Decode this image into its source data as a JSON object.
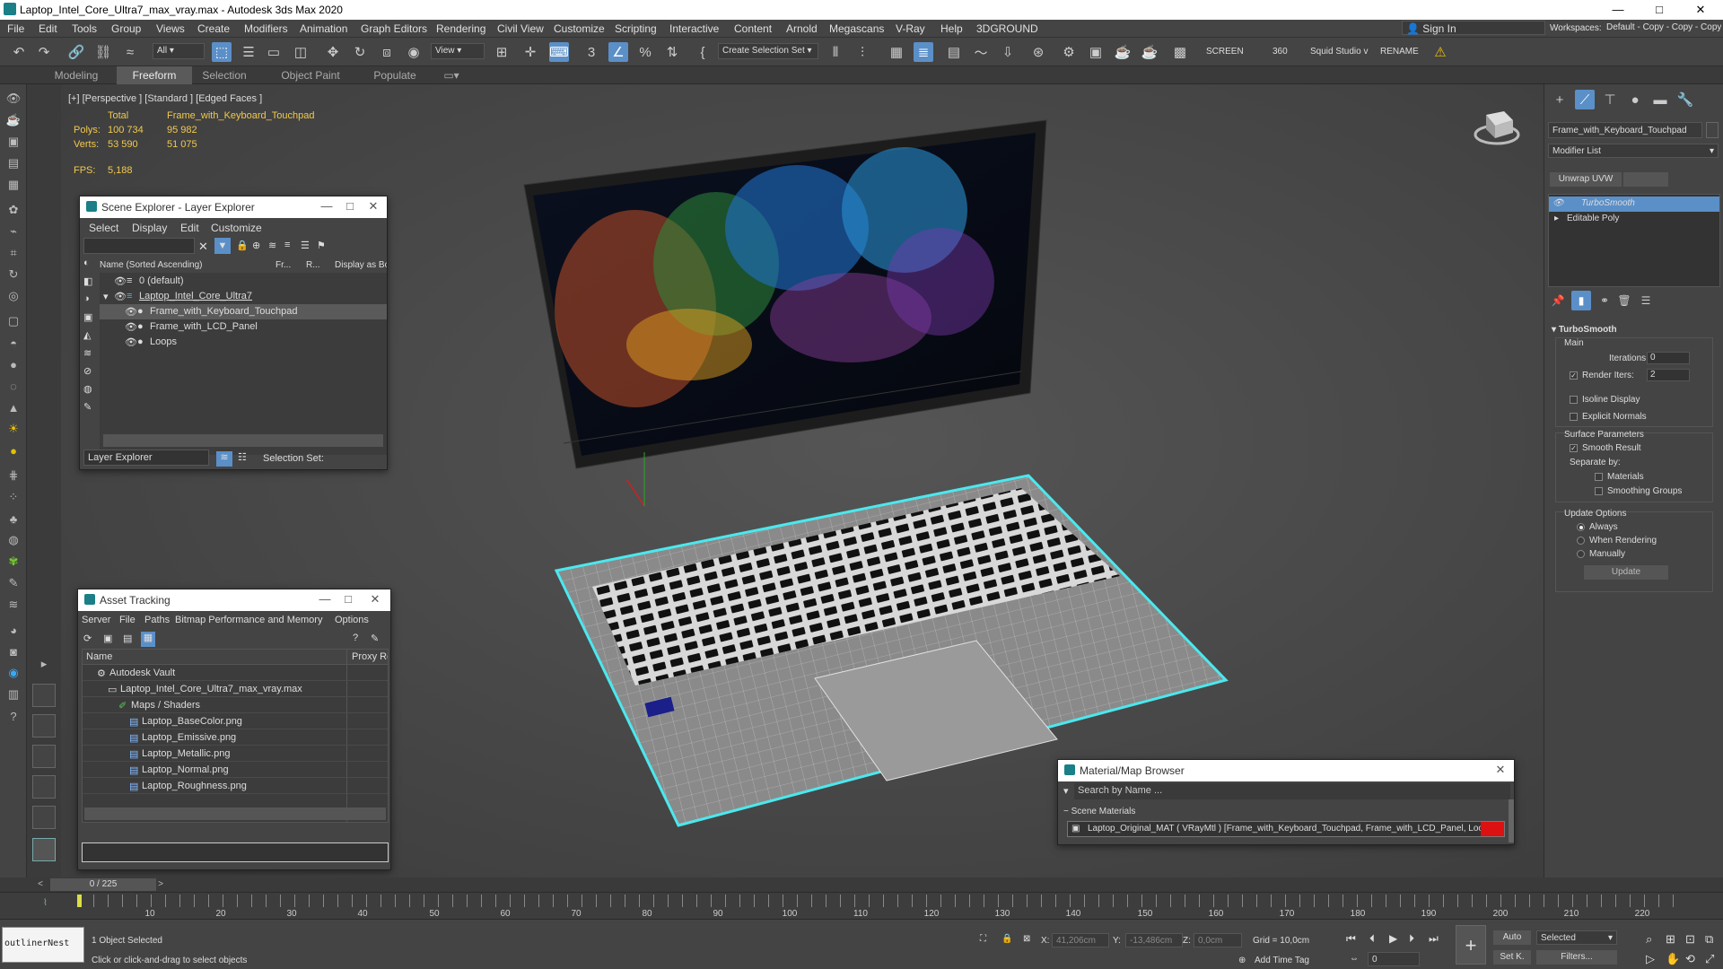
{
  "titlebar": {
    "title": "Laptop_Intel_Core_Ultra7_max_vray.max - Autodesk 3ds Max 2020",
    "min": "—",
    "max": "□",
    "close": "✕"
  },
  "menu": [
    "File",
    "Edit",
    "Tools",
    "Group",
    "Views",
    "Create",
    "Modifiers",
    "Animation",
    "Graph Editors",
    "Rendering",
    "Civil View",
    "Customize",
    "Scripting",
    "Interactive",
    "Content",
    "Arnold",
    "Megascans",
    "V-Ray",
    "Help",
    "3DGROUND"
  ],
  "signin": "Sign In",
  "workspaces_label": "Workspaces:",
  "workspaces_value": "Default - Copy - Copy - Copy - Copy",
  "toolbar": {
    "filter_dropdown": "All",
    "view_dropdown": "View",
    "selection_set": "Create Selection Set",
    "screen": "SCREEN",
    "num360": "360",
    "squid": "Squid Studio v",
    "rename": "RENAME"
  },
  "ribbon_tabs": [
    "Modeling",
    "Freeform",
    "Selection",
    "Object Paint",
    "Populate"
  ],
  "viewport": {
    "label": "[+] [Perspective ] [Standard ] [Edged Faces ]",
    "stats": {
      "total_label": "Total",
      "object_name": "Frame_with_Keyboard_Touchpad",
      "polys_label": "Polys:",
      "polys_total": "100 734",
      "polys_obj": "95 982",
      "verts_label": "Verts:",
      "verts_total": "53 590",
      "verts_obj": "51 075",
      "fps_label": "FPS:",
      "fps_value": "5,188"
    }
  },
  "scene_explorer": {
    "title": "Scene Explorer - Layer Explorer",
    "menu": [
      "Select",
      "Display",
      "Edit",
      "Customize"
    ],
    "columns": [
      "Name (Sorted Ascending)",
      "Fr...",
      "R...",
      "Display as Box"
    ],
    "rows": [
      {
        "name": "0 (default)"
      },
      {
        "name": "Laptop_Intel_Core_Ultra7"
      },
      {
        "name": "Frame_with_Keyboard_Touchpad"
      },
      {
        "name": "Frame_with_LCD_Panel"
      },
      {
        "name": "Loops"
      }
    ],
    "footer_dropdown": "Layer Explorer",
    "selection_set": "Selection Set:"
  },
  "asset_tracking": {
    "title": "Asset Tracking",
    "menu": [
      "Server",
      "File",
      "Paths",
      "Bitmap Performance and Memory",
      "Options"
    ],
    "columns": [
      "Name",
      "Proxy Re"
    ],
    "rows": [
      {
        "name": "Autodesk Vault"
      },
      {
        "name": "Laptop_Intel_Core_Ultra7_max_vray.max"
      },
      {
        "name": "Maps / Shaders"
      },
      {
        "name": "Laptop_BaseColor.png"
      },
      {
        "name": "Laptop_Emissive.png"
      },
      {
        "name": "Laptop_Metallic.png"
      },
      {
        "name": "Laptop_Normal.png"
      },
      {
        "name": "Laptop_Roughness.png"
      }
    ]
  },
  "material_browser": {
    "title": "Material/Map Browser",
    "search_placeholder": "Search by Name ...",
    "section": "Scene Materials",
    "item": "Laptop_Original_MAT  ( VRayMtl )  [Frame_with_Keyboard_Touchpad, Frame_with_LCD_Panel, Loops]"
  },
  "command_panel": {
    "object_name": "Frame_with_Keyboard_Touchpad",
    "modifier_list": "Modifier List",
    "unwrap_uvw": "Unwrap UVW",
    "stack": [
      "TurboSmooth",
      "Editable Poly"
    ],
    "rollout": "TurboSmooth",
    "main": "Main",
    "iterations_label": "Iterations:",
    "iterations": "0",
    "render_iters_label": "Render Iters:",
    "render_iters": "2",
    "isoline": "Isoline Display",
    "explicit_normals": "Explicit Normals",
    "surface_params": "Surface Parameters",
    "smooth_result": "Smooth Result",
    "separate_by": "Separate by:",
    "materials": "Materials",
    "smoothing_groups": "Smoothing Groups",
    "update_options": "Update Options",
    "always": "Always",
    "when_rendering": "When Rendering",
    "manually": "Manually",
    "update_button": "Update"
  },
  "timeline": {
    "frame": "0 / 225",
    "ticks": [
      "10",
      "20",
      "30",
      "40",
      "50",
      "60",
      "70",
      "80",
      "90",
      "100",
      "110",
      "120",
      "130",
      "140",
      "150",
      "160",
      "170",
      "180",
      "190",
      "200",
      "210",
      "220"
    ]
  },
  "status": {
    "script_box": "outlinerNest",
    "selected": "1 Object Selected",
    "prompt": "Click or click-and-drag to select objects",
    "x_label": "X:",
    "x_val": "41,206cm",
    "y_label": "Y:",
    "y_val": "-13,486cm",
    "z_label": "Z:",
    "z_val": "0,0cm",
    "grid": "Grid = 10,0cm",
    "add_time_tag": "Add Time Tag",
    "auto": "Auto",
    "setk": "Set K.",
    "selected_dropdown": "Selected",
    "filters": "Filters...",
    "frame_spin": "0"
  }
}
